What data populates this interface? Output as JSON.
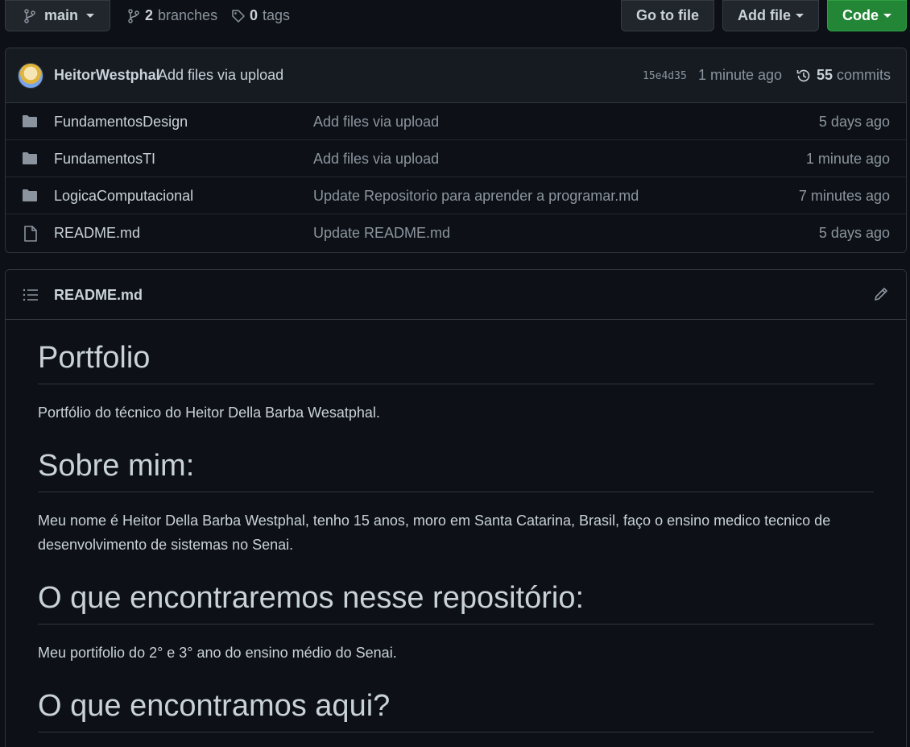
{
  "toolbar": {
    "branch": "main",
    "branches_count": "2",
    "branches_label": "branches",
    "tags_count": "0",
    "tags_label": "tags",
    "go_to_file": "Go to file",
    "add_file": "Add file",
    "code": "Code"
  },
  "commit": {
    "author": "HeitorWestphal",
    "message": "Add files via upload",
    "sha": "15e4d35",
    "time": "1 minute ago",
    "commits_count": "55",
    "commits_label": "commits"
  },
  "files": [
    {
      "name": "FundamentosDesign",
      "type": "folder",
      "commit": "Add files via upload",
      "time": "5 days ago"
    },
    {
      "name": "FundamentosTI",
      "type": "folder",
      "commit": "Add files via upload",
      "time": "1 minute ago"
    },
    {
      "name": "LogicaComputacional",
      "type": "folder",
      "commit": "Update Repositorio para aprender a programar.md",
      "time": "7 minutes ago"
    },
    {
      "name": "README.md",
      "type": "file",
      "commit": "Update README.md",
      "time": "5 days ago"
    }
  ],
  "readme": {
    "title": "README.md",
    "h1_portfolio": "Portfolio",
    "p_portfolio": "Portfólio do técnico do Heitor Della Barba Wesatphal.",
    "h1_sobre": "Sobre mim:",
    "p_sobre": "Meu nome é Heitor Della Barba Westphal, tenho 15 anos, moro em Santa Catarina, Brasil, faço o ensino medico tecnico de desenvolvimento de sistemas no Senai.",
    "h1_encontraremos": "O que encontraremos nesse repositório:",
    "p_encontraremos": "Meu portifolio do 2° e 3° ano do ensino médio do Senai.",
    "h1_aqui": "O que encontramos aqui?"
  }
}
